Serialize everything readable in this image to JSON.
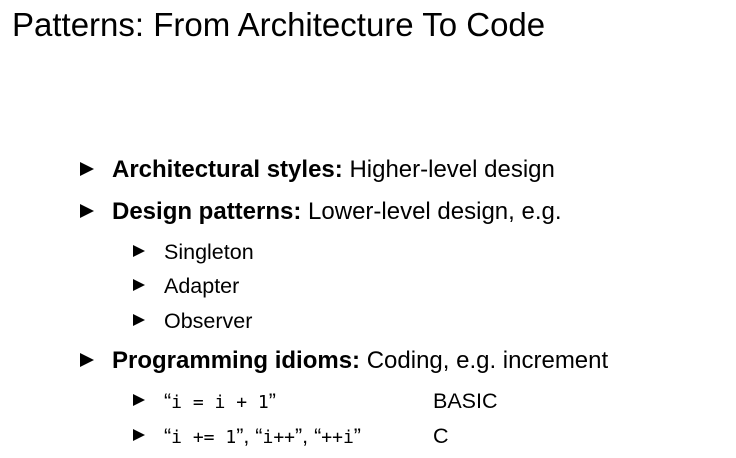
{
  "slide": {
    "title": "Patterns: From Architecture To Code",
    "items": [
      {
        "term": "Architectural styles:",
        "text": "Higher-level design"
      },
      {
        "term": "Design patterns:",
        "text": "Lower-level design, e.g.",
        "subitems": [
          "Singleton",
          "Adapter",
          "Observer"
        ]
      },
      {
        "term": "Programming idioms:",
        "text": "Coding, e.g. increment",
        "subitems": [
          {
            "parts": [
              {
                "t": "“",
                "mono": false
              },
              {
                "t": "i = i + 1",
                "mono": true
              },
              {
                "t": "”",
                "mono": false
              }
            ],
            "language": "BASIC"
          },
          {
            "parts": [
              {
                "t": "“",
                "mono": false
              },
              {
                "t": "i += 1",
                "mono": true
              },
              {
                "t": "”, “",
                "mono": false
              },
              {
                "t": "i++",
                "mono": true
              },
              {
                "t": "”, “",
                "mono": false
              },
              {
                "t": "++i",
                "mono": true
              },
              {
                "t": "”",
                "mono": false
              }
            ],
            "language": "C"
          }
        ]
      }
    ]
  }
}
